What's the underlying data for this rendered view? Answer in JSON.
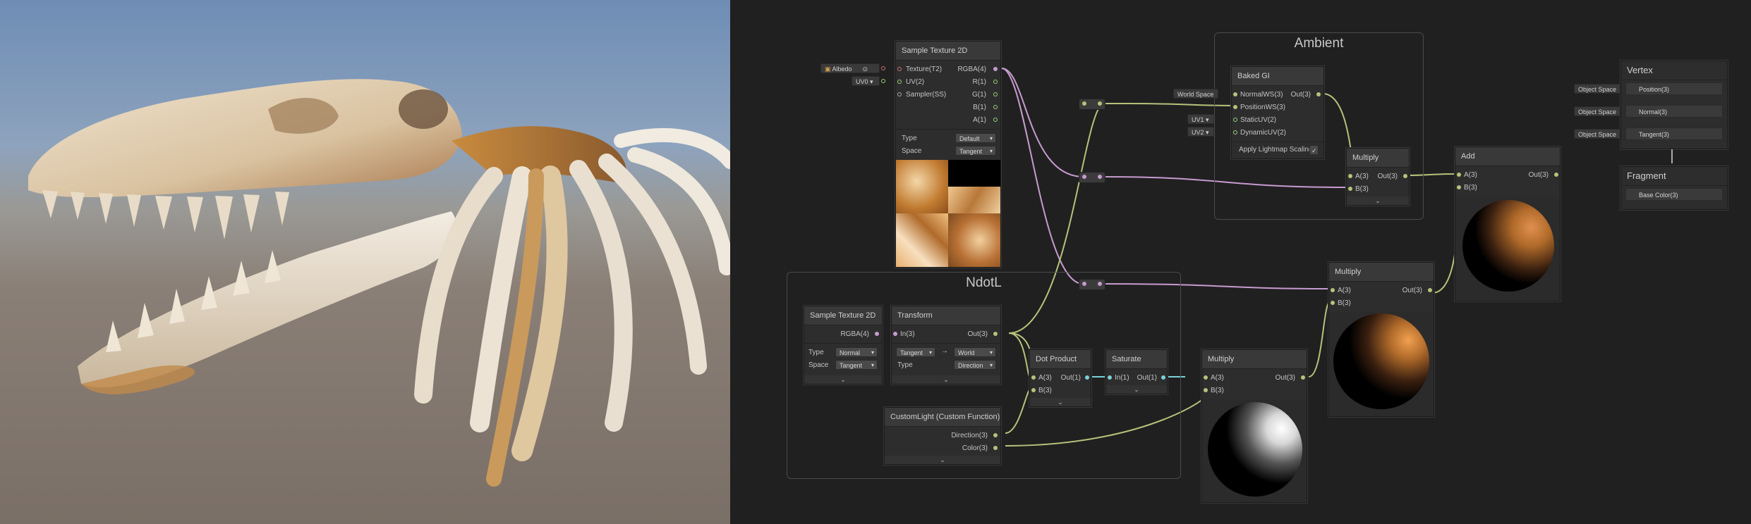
{
  "viewport": {
    "subject": "dinosaur skull and rib cage 3D preview"
  },
  "groups": {
    "ambient": "Ambient",
    "ndotl": "NdotL"
  },
  "sample_texture_top": {
    "title": "Sample Texture 2D",
    "inputs": [
      "Texture(T2)",
      "UV(2)",
      "Sampler(SS)"
    ],
    "outputs": [
      "RGBA(4)",
      "R(1)",
      "G(1)",
      "B(1)",
      "A(1)"
    ],
    "type_label": "Type",
    "type_value": "Default",
    "space_label": "Space",
    "space_value": "Tangent",
    "albedo_pill": "Albedo",
    "uv_pill": "UV0"
  },
  "baked_gi": {
    "title": "Baked GI",
    "inputs": [
      "NormalWS(3)",
      "PositionWS(3)",
      "StaticUV(2)",
      "DynamicUV(2)"
    ],
    "output": "Out(3)",
    "world_space_pill": "World Space",
    "uv1_pill": "UV1",
    "uv2_pill": "UV2",
    "lightmap_label": "Apply Lightmap Scaling",
    "lightmap_check": "✓"
  },
  "multiply_ambient": {
    "title": "Multiply",
    "inputs": [
      "A(3)",
      "B(3)"
    ],
    "output": "Out(3)",
    "footer": "⌄"
  },
  "add_node": {
    "title": "Add",
    "inputs": [
      "A(3)",
      "B(3)"
    ],
    "output": "Out(3)"
  },
  "vertex": {
    "title": "Vertex",
    "ports": [
      "Position(3)",
      "Normal(3)",
      "Tangent(3)"
    ],
    "pills": [
      "Object Space",
      "Object Space",
      "Object Space"
    ]
  },
  "fragment": {
    "title": "Fragment",
    "ports": [
      "Base Color(3)"
    ]
  },
  "sample_texture_ndotl": {
    "title": "Sample Texture 2D",
    "output": "RGBA(4)",
    "type_label": "Type",
    "type_value": "Normal",
    "space_label": "Space",
    "space_value": "Tangent"
  },
  "transform": {
    "title": "Transform",
    "input": "In(3)",
    "output": "Out(3)",
    "from_value": "Tangent",
    "arrow": "→",
    "to_value": "World",
    "type_label": "Type",
    "type_value": "Direction"
  },
  "dot_product": {
    "title": "Dot Product",
    "inputs": [
      "A(3)",
      "B(3)"
    ],
    "output": "Out(1)"
  },
  "saturate": {
    "title": "Saturate",
    "input": "In(1)",
    "output": "Out(1)"
  },
  "custom_light": {
    "title": "CustomLight (Custom Function)",
    "outputs": [
      "Direction(3)",
      "Color(3)"
    ]
  },
  "multiply_ndotl": {
    "title": "Multiply",
    "inputs": [
      "A(3)",
      "B(3)"
    ],
    "output": "Out(3)"
  },
  "multiply_mid": {
    "title": "Multiply",
    "inputs": [
      "A(3)",
      "B(3)"
    ],
    "output": "Out(3)"
  },
  "colors": {
    "wire_vector": "#b7c27a",
    "wire_color": "#c79bd0",
    "wire_float": "#7ad0d8",
    "background": "#202020"
  }
}
